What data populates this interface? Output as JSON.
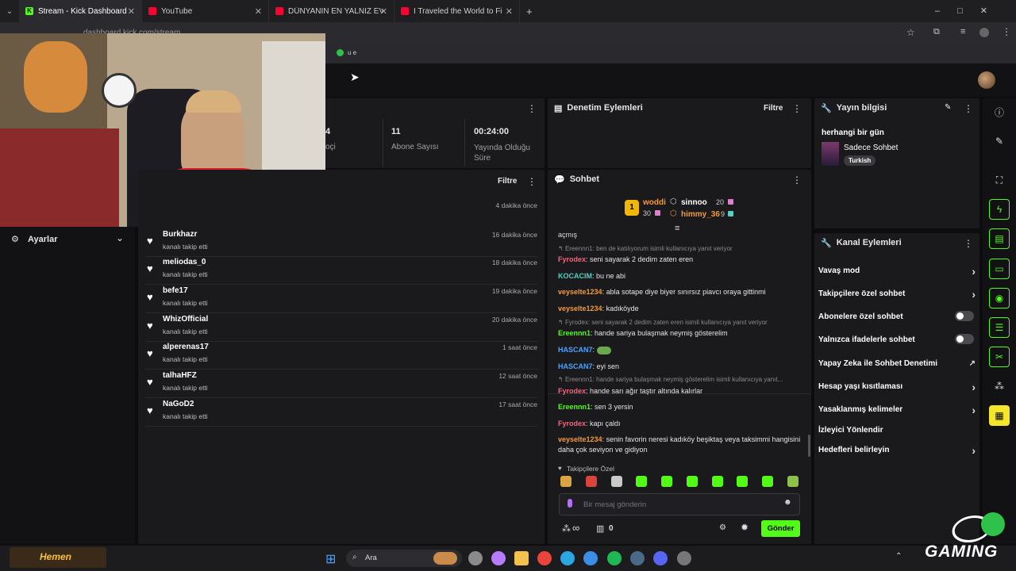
{
  "browser": {
    "tabs": [
      {
        "title": "Stream - Kick Dashboard",
        "icon": "kick-icon",
        "active": true
      },
      {
        "title": "YouTube",
        "icon": "youtube-icon",
        "active": false
      },
      {
        "title": "DÜNYANIN EN YALNIZ EVİNDE",
        "icon": "youtube-icon",
        "active": false
      },
      {
        "title": "I Traveled the World to Find the",
        "icon": "youtube-icon",
        "active": false
      }
    ],
    "new_tab": "+",
    "url": "dashboard.kick.com/stream",
    "bookmark_text": "u e"
  },
  "stats": [
    {
      "value": "4",
      "label": "oçi"
    },
    {
      "value": "11",
      "label": "Abone Sayısı"
    },
    {
      "value": "00:24:00",
      "label": "Yayında Olduğu Süre"
    }
  ],
  "settings": {
    "label": "Ayarlar"
  },
  "activity": {
    "filter_label": "Filtre",
    "first_time": "4 dakika önce",
    "items": [
      {
        "name": "Burkhazr",
        "action": "kanalı takip etti",
        "time": "16 dakika önce"
      },
      {
        "name": "meliodas_0",
        "action": "kanalı takip etti",
        "time": "18 dakika önce"
      },
      {
        "name": "befe17",
        "action": "kanalı takip etti",
        "time": "19 dakika önce"
      },
      {
        "name": "WhizOfficial",
        "action": "kanalı takip etti",
        "time": "20 dakika önce"
      },
      {
        "name": "alperenas17",
        "action": "kanalı takip etti",
        "time": "1 saat önce"
      },
      {
        "name": "talhaHFZ",
        "action": "kanalı takip etti",
        "time": "12 saat önce"
      },
      {
        "name": "NaGoD2",
        "action": "kanalı takip etti",
        "time": "17 saat önce"
      }
    ]
  },
  "moderation": {
    "title": "Denetim Eylemleri",
    "filter_label": "Filtre"
  },
  "chat": {
    "title": "Sohbet",
    "leaderboard": {
      "first": {
        "rank": "1",
        "name": "woddi",
        "count": "30"
      },
      "second": {
        "name": "sinnoo",
        "count": "20"
      },
      "third": {
        "name": "himmy_36",
        "count": "9"
      }
    },
    "partial": "açmış",
    "messages": [
      {
        "reply": "Ereennn1: ben de katılıyorum isimli kullanıcıya yanıt veriyor",
        "user": "Fyrodex",
        "color": "pink",
        "text": "seni sayarak 2 dedim zaten eren"
      },
      {
        "user": "KOCACIM",
        "color": "teal",
        "text": "bu ne abi"
      },
      {
        "user": "veyselte1234",
        "color": "orange",
        "text": "abla sotape diye biyer sınırsız piavcı oraya gittinmi"
      },
      {
        "user": "veyselte1234",
        "color": "orange",
        "text": "kadıköyde"
      },
      {
        "reply": "Fyrodex: seni sayarak 2 dedim zaten eren isimli kullanıcıya yanıt veriyor",
        "user": "Ereennn1",
        "color": "green",
        "text": "hande sariya bulaşmak neymiş gösterelim"
      },
      {
        "user": "HASCAN7",
        "color": "blue",
        "text": ""
      },
      {
        "user": "HASCAN7",
        "color": "blue",
        "text": "eyi sen"
      },
      {
        "reply": "Ereennn1: hande sariya bulaşmak neymiş gösterelim isimli kullanıcıya yanıt...",
        "user": "Fyrodex",
        "color": "pink",
        "text": "hande sarı ağır taştır altında kalırlar"
      },
      {
        "user": "Ereennn1",
        "color": "green",
        "text": "sen 3 yersin"
      },
      {
        "user": "Fyrodex",
        "color": "pink",
        "text": "kapı çaldı"
      },
      {
        "user": "veyselte1234",
        "color": "orange",
        "text": "senin favorin neresi kadıköy beşiktaş veya taksimmi hangisini daha çok seviyon ve gidiyon"
      }
    ],
    "followers_only": "Takipçilere Özel",
    "input_placeholder": "Bir mesaj gönderin",
    "viewer_count": "0",
    "infinity": "∞",
    "send_label": "Gönder"
  },
  "stream_info": {
    "title": "Yayın bilgisi",
    "stream_title": "herhangi bir gün",
    "category": "Sadece Sohbet",
    "tag": "Turkish"
  },
  "channel_actions": {
    "title": "Kanal Eylemleri",
    "items": [
      {
        "label": "Vavaş mod",
        "control": "chevron"
      },
      {
        "label": "Takipçilere özel sohbet",
        "control": "chevron"
      },
      {
        "label": "Abonelere özel sohbet",
        "control": "toggle"
      },
      {
        "label": "Yalnızca ifadelerle sohbet",
        "control": "toggle"
      },
      {
        "label": "Yapay Zeka ile Sohbet Denetimi",
        "control": "external"
      },
      {
        "label": "Hesap yaşı kısıtlaması",
        "control": "chevron"
      },
      {
        "label": "Yasaklanmış kelimeler",
        "control": "chevron"
      },
      {
        "label": "İzleyici Yönlendir",
        "control": "none"
      },
      {
        "label": "Hedefleri belirleyin",
        "control": "chevron"
      }
    ]
  },
  "taskbar": {
    "search_label": "Ara",
    "widget_text": "Hemen"
  },
  "watermark": {
    "text": "GAMING"
  }
}
